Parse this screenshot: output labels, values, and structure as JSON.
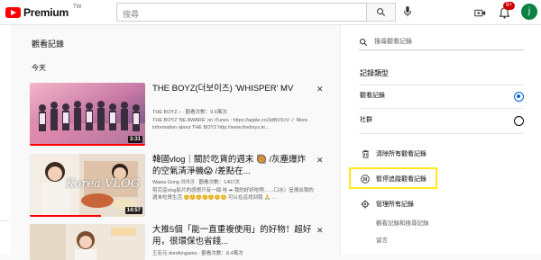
{
  "header": {
    "logo_text": "Premium",
    "region": "TW",
    "search_placeholder": "搜尋",
    "notification_count": "9+",
    "avatar_letter": "j"
  },
  "main": {
    "title": "觀看記錄",
    "section": "今天",
    "videos": [
      {
        "title": "THE BOYZ(더보이즈) 'WHISPER' MV",
        "channel": "THE BOYZ ♪",
        "views": "觀看次數：9.6萬次",
        "desc": "THE BOYZ 'BE AWARE' on iTunes : https://apple.co/3dBVXcV ✓ More information about THE BOYZ http://www.theboyz.kr...",
        "duration": "3:31",
        "progress": 1.0
      },
      {
        "title": "韓國vlog｜關於吃貨的週末 🥘 /灰塵爆炸的空氣清淨機😱 /差點在...",
        "channel": "Wawa Gong 와와공",
        "views": "觀看次數：1407次",
        "desc": "剪完這vlog影片的感想只有一個 哇 ➡ 我的好好吃啊……口水）呈現出我的週末吃貨生活 ☺️☺️☺️☺️☺️☺️☺️ 可以在這找到我 🙏 ...",
        "duration": "14:57",
        "progress": 0.62
      },
      {
        "title": "大推5個「能一直重複使用」的好物！超好用，很環保也省錢...",
        "channel": "王宏元 dontkingame",
        "views": "觀看次數：8.4萬次",
        "desc": "",
        "duration": "",
        "progress": 0
      }
    ],
    "thumb_text_2": "Korea VLOG"
  },
  "sidebar": {
    "search_placeholder": "搜尋觀看記錄",
    "history_type_title": "記錄類型",
    "types": [
      {
        "label": "觀看記錄",
        "selected": true
      },
      {
        "label": "社群",
        "selected": false
      }
    ],
    "clear_label": "清除所有觀看記錄",
    "pause_label": "暫停追蹤觀看記錄",
    "manage_label": "管理所有記錄",
    "sub_links": [
      "觀看記錄和搜尋記錄",
      "留言"
    ]
  },
  "colors": {
    "accent": "#065fd4",
    "brand_red": "#ff0000",
    "highlight": "#ffe81a"
  }
}
